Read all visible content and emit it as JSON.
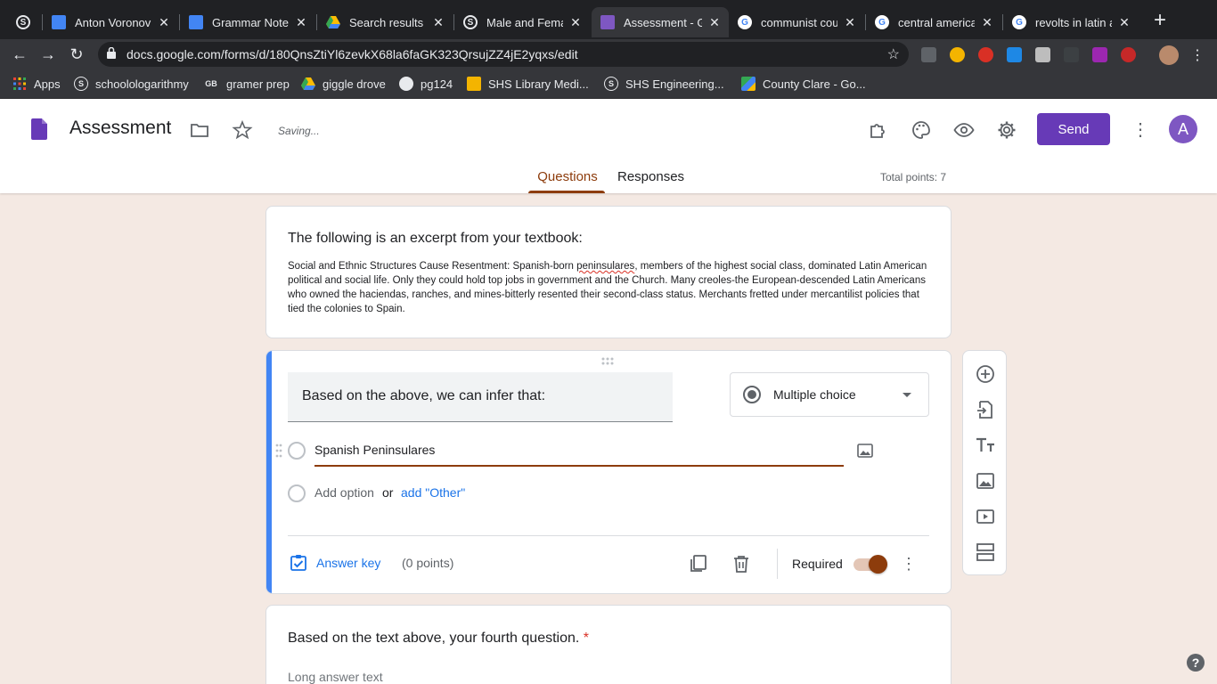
{
  "browser": {
    "tabs": [
      {
        "title": "",
        "active": false
      },
      {
        "title": "Anton Voronov -",
        "active": false
      },
      {
        "title": "Grammar Notes",
        "active": false
      },
      {
        "title": "Search results -",
        "active": false
      },
      {
        "title": "Male and Femal",
        "active": false
      },
      {
        "title": "Assessment - G",
        "active": true
      },
      {
        "title": "communist cou",
        "active": false
      },
      {
        "title": "central america",
        "active": false
      },
      {
        "title": "revolts in latin a",
        "active": false
      }
    ],
    "url": "docs.google.com/forms/d/180QnsZtiYl6zevkX68la6faGK323QrsujZZ4jE2yqxs/edit",
    "bookmarks": [
      {
        "label": "Apps",
        "icon": "apps-grid-icon"
      },
      {
        "label": "schoolologarithmy",
        "icon": "schoology-icon"
      },
      {
        "label": "gramer prep",
        "icon": "gb-icon"
      },
      {
        "label": "giggle drove",
        "icon": "drive-icon"
      },
      {
        "label": "pg124",
        "icon": "globe-icon"
      },
      {
        "label": "SHS Library Medi...",
        "icon": "library-icon"
      },
      {
        "label": "SHS Engineering...",
        "icon": "schoology-icon"
      },
      {
        "label": "County Clare - Go...",
        "icon": "maps-icon"
      }
    ]
  },
  "header": {
    "title": "Assessment",
    "status": "Saving...",
    "send_label": "Send",
    "avatar_initial": "A",
    "tabs": {
      "questions": "Questions",
      "responses": "Responses"
    },
    "total_points": "Total points: 7"
  },
  "excerpt": {
    "title": "The following is an excerpt from your textbook:",
    "body_before": "Social and Ethnic Structures Cause Resentment: Spanish-born ",
    "body_misspelled": "peninsulares",
    "body_after": ", members of the highest social class, dominated Latin American political and social life. Only they could hold top jobs in government and the Church. Many creoles-the European-descended Latin Americans who owned the haciendas, ranches, and mines-bitterly resented their second-class status. Merchants fretted under mercantilist policies that tied the colonies to Spain."
  },
  "question": {
    "title": "Based on the above, we can infer that:",
    "type": "Multiple choice",
    "option1": "Spanish Peninsulares",
    "add_option": "Add option",
    "or": "or",
    "add_other": "add \"Other\"",
    "answer_key": "Answer key",
    "points": "(0 points)",
    "required_label": "Required",
    "required": true
  },
  "question4": {
    "title": "Based on the text above, your fourth question.",
    "required_star": "*",
    "placeholder": "Long answer text"
  },
  "colors": {
    "accent": "#8d3c0c",
    "forms_purple": "#673ab7",
    "link_blue": "#1a73e8",
    "active_card": "#4285f4",
    "page_bg": "#f4e9e3"
  }
}
